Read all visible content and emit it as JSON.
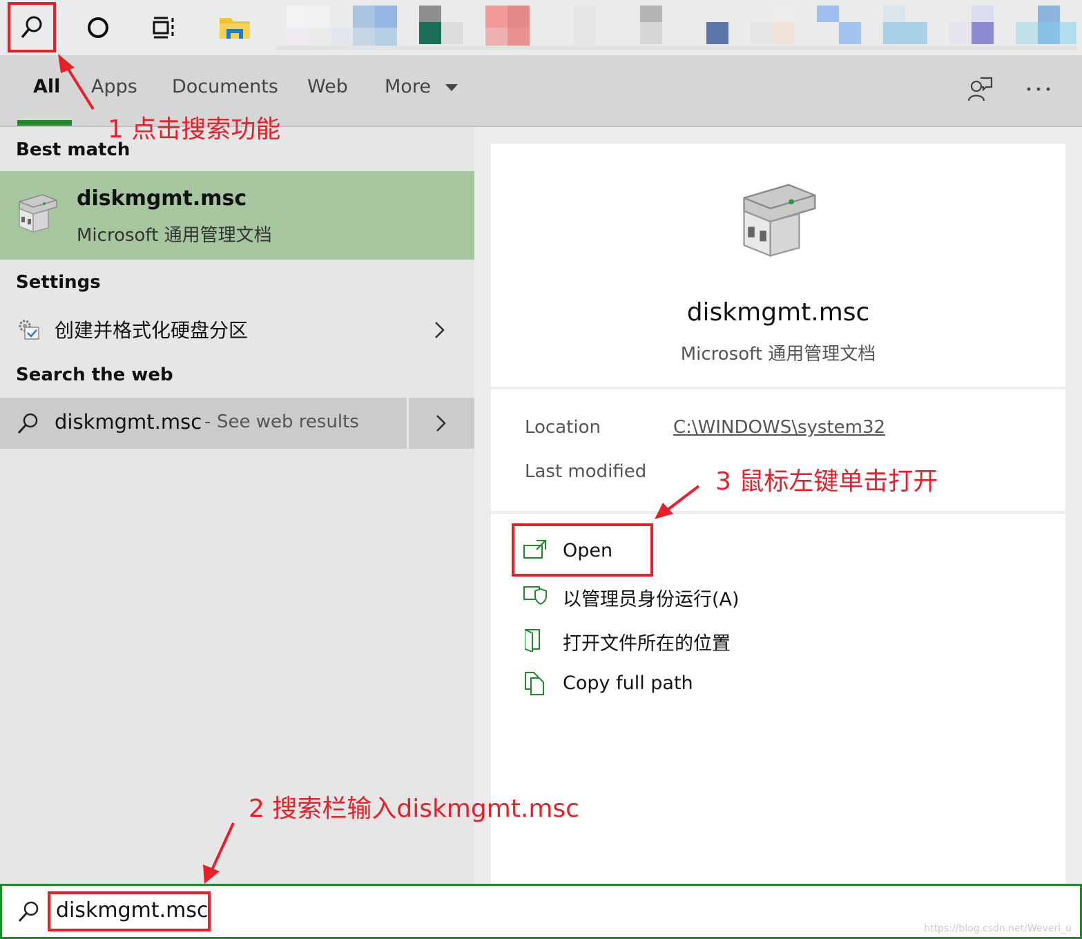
{
  "tabs": {
    "all": "All",
    "apps": "Apps",
    "documents": "Documents",
    "web": "Web",
    "more": "More"
  },
  "results": {
    "best_match_heading": "Best match",
    "best_match": {
      "title": "diskmgmt.msc",
      "subtitle": "Microsoft 通用管理文档"
    },
    "settings_heading": "Settings",
    "settings_item": "创建并格式化硬盘分区",
    "web_heading": "Search the web",
    "web_item": {
      "query": "diskmgmt.msc",
      "separator": "-",
      "suffix": "See web results"
    }
  },
  "preview": {
    "title": "diskmgmt.msc",
    "subtitle": "Microsoft 通用管理文档",
    "location_label": "Location",
    "location_value": "C:\\WINDOWS\\system32",
    "modified_label": "Last modified",
    "actions": [
      {
        "label": "Open",
        "icon": "open-icon"
      },
      {
        "label": "以管理员身份运行(A)",
        "icon": "shield-icon"
      },
      {
        "label": "打开文件所在的位置",
        "icon": "folder-location-icon"
      },
      {
        "label": "Copy full path",
        "icon": "copy-icon"
      }
    ]
  },
  "search": {
    "value": "diskmgmt.msc"
  },
  "annotations": {
    "step1": "1 点击搜索功能",
    "step2": "2 搜索栏输入diskmgmt.msc",
    "step3": "3 鼠标左键单击打开"
  },
  "watermark": "https://blog.csdn.net/Weverl_u",
  "colors": {
    "accent_green": "#1e8a29",
    "selection_green": "#a6c6a0",
    "annotation_red": "#e8202a"
  }
}
